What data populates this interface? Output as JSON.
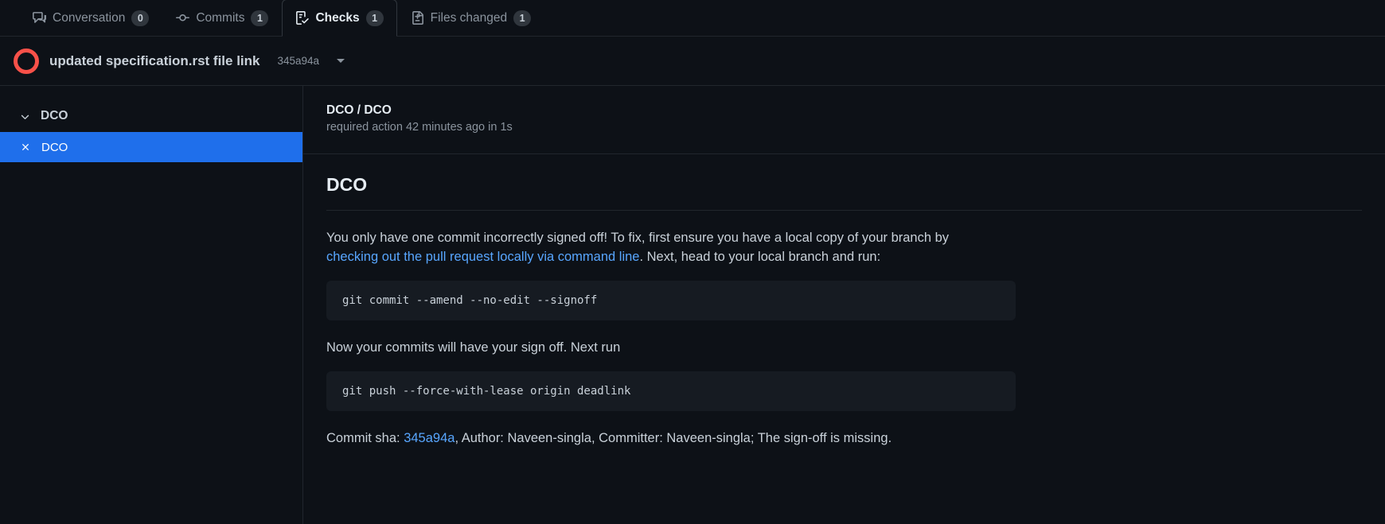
{
  "tabs": [
    {
      "label": "Conversation",
      "count": "0",
      "icon": "comment-discussion-icon",
      "selected": false
    },
    {
      "label": "Commits",
      "count": "1",
      "icon": "git-commit-icon",
      "selected": false
    },
    {
      "label": "Checks",
      "count": "1",
      "icon": "checklist-icon",
      "selected": true
    },
    {
      "label": "Files changed",
      "count": "1",
      "icon": "file-diff-icon",
      "selected": false
    }
  ],
  "commit_header": {
    "status_icon": "failure-circle-icon",
    "title": "updated specification.rst file link",
    "sha": "345a94a",
    "caret": "chevron-down-icon"
  },
  "sidebar": {
    "group": {
      "label": "DCO",
      "chevron": "chevron-down-icon"
    },
    "checks": [
      {
        "label": "DCO",
        "status_icon": "x-icon",
        "selected": true
      }
    ]
  },
  "main": {
    "check_name": "DCO / DCO",
    "check_meta": "required action 42 minutes ago in 1s",
    "section_title": "DCO",
    "paragraph1": {
      "text_before": "You only have one commit incorrectly signed off! To fix, first ensure you have a local copy of your branch by ",
      "link_text": "checking out the pull request locally via command line",
      "text_after": ". Next, head to your local branch and run:"
    },
    "code1": "git commit --amend --no-edit --signoff",
    "paragraph2": "Now your commits will have your sign off. Next run",
    "code2": "git push --force-with-lease origin deadlink",
    "footer": {
      "text_before": "Commit sha: ",
      "sha_link": "345a94a",
      "text_after": ", Author: Naveen-singla, Committer: Naveen-singla; The sign-off is missing."
    }
  },
  "colors": {
    "background": "#0d1117",
    "accent_blue": "#1f6feb",
    "link_blue": "#58a6ff",
    "failure_red": "#f85149",
    "border": "#21262d",
    "code_bg": "#161b22"
  }
}
